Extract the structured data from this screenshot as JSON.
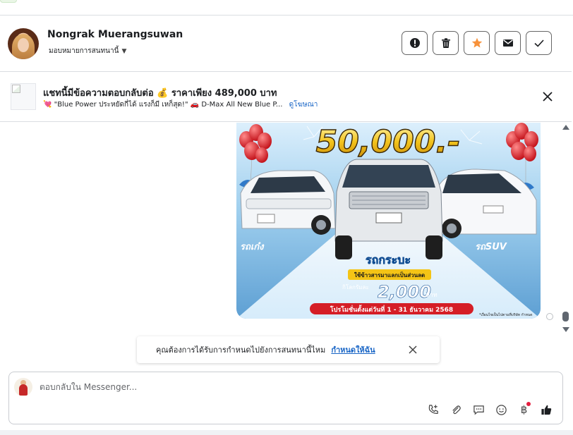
{
  "header": {
    "contact_name": "Nongrak Muerangsuwan",
    "assign_label": "มอบหมายการสนทนานี้",
    "actions": [
      {
        "icon": "alert-icon",
        "name": "flag-button"
      },
      {
        "icon": "trash-icon",
        "name": "delete-button"
      },
      {
        "icon": "star-icon",
        "name": "star-button"
      },
      {
        "icon": "envelope-icon",
        "name": "mark-unread-button"
      },
      {
        "icon": "check-icon",
        "name": "mark-done-button"
      }
    ],
    "star_color": "#f7923b"
  },
  "ad_context": {
    "title": "แชทนี้มีข้อความตอบกลับต่อ 💰 ราคาเพียง 489,000 บาท",
    "subtitle": "💘 \"Blue Power ประหยัดกี่ได้ แรงก็มี เหก็สุด!\" 🚗 D-Max All New Blue P...",
    "view_ad_link": "ดูโฆษณา"
  },
  "promo_image": {
    "headline": "50,000.-",
    "left_label": "รถเก๋ง",
    "right_label": "รถSUV",
    "center_label": "รถกระบะ",
    "tag": "ใช้ข้าวสารมาแลกเป็นส่วนลด",
    "kilo_label": "กิโลกรัมละ",
    "kilo_price": "2,000",
    "kilo_unit": "บาท",
    "promo_period": "โปรโมชั่นตั้งแต่วันที่ 1 - 31 ธันวาคม 2568",
    "fine_print": "*เงื่อนไขเป็นไปตามที่บริษัท กำหนด"
  },
  "assign_prompt": {
    "question": "คุณต้องการได้รับการกำหนดไปยังการสนทนานี้ไหม",
    "cta": "กำหนดให้ฉัน"
  },
  "composer": {
    "placeholder": "ตอบกลับใน Messenger...",
    "tools": [
      "call-add-icon",
      "paperclip-icon",
      "chat-bubble-icon",
      "emoji-icon",
      "baht-icon",
      "thumbs-up-icon"
    ],
    "baht_symbol": "฿"
  },
  "colors": {
    "link_blue": "#1a66c6",
    "border": "#dadde1",
    "notification_red": "#e41e3f"
  }
}
